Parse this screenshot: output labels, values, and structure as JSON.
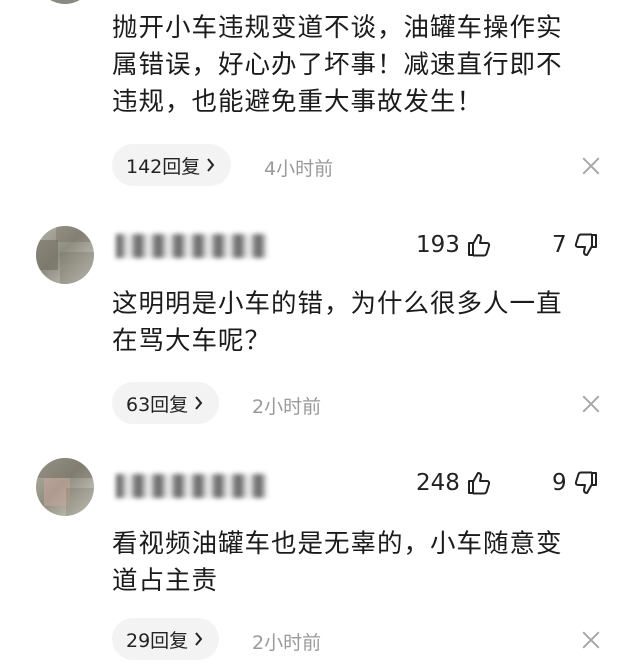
{
  "comments": [
    {
      "text_lines": [
        "抛开小车违规变道不谈，油罐车操作实",
        "属错误，好心办了坏事！减速直行即不",
        "违规，也能避免重大事故发生！"
      ],
      "replies": "142回复",
      "time": "4小时前"
    },
    {
      "likes": "193",
      "dislikes": "7",
      "text_lines": [
        "这明明是小车的错，为什么很多人一直",
        "在骂大车呢？"
      ],
      "replies": "63回复",
      "time": "2小时前"
    },
    {
      "likes": "248",
      "dislikes": "9",
      "text_lines": [
        "看视频油罐车也是无辜的，小车随意变",
        "道占主责"
      ],
      "replies": "29回复",
      "time": "2小时前"
    }
  ],
  "icons": {
    "like": "thumbs-up-icon",
    "dislike": "thumbs-down-icon",
    "reply_arrow": "chevron-right-icon",
    "close": "close-icon"
  }
}
